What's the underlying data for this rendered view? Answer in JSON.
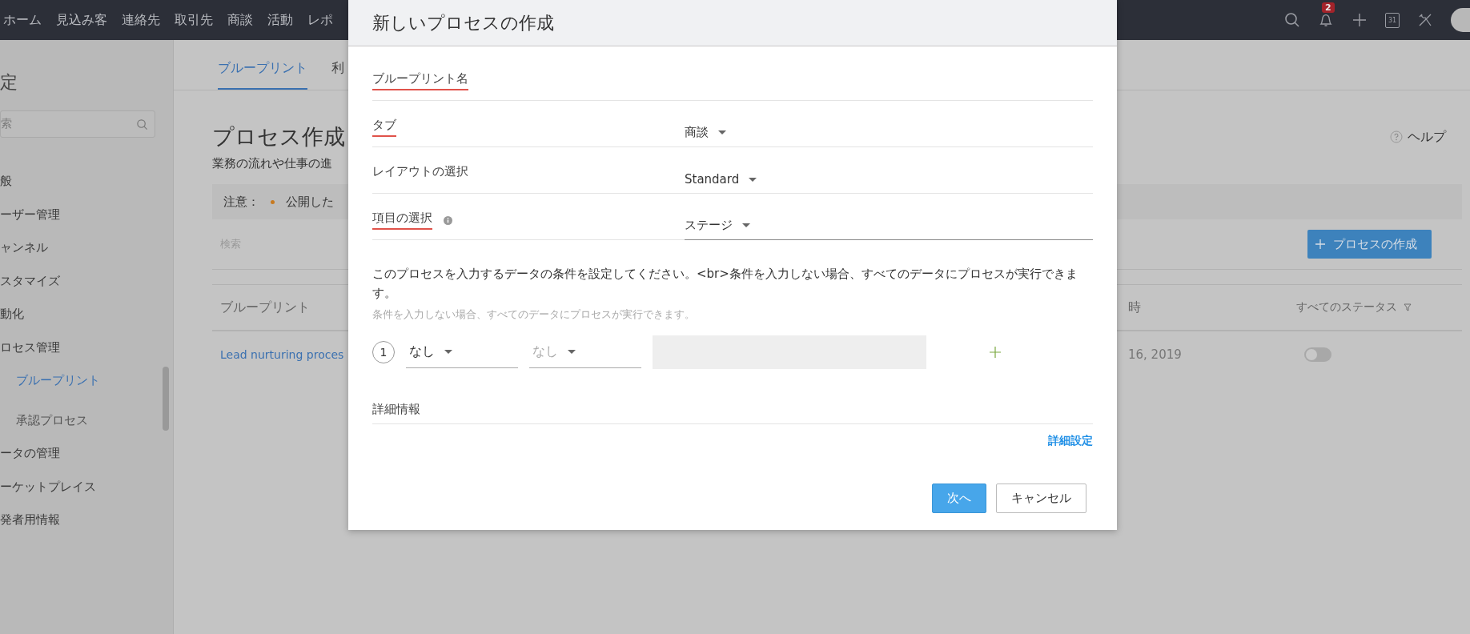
{
  "topbar": {
    "nav": [
      "ホーム",
      "見込み客",
      "連絡先",
      "取引先",
      "商談",
      "活動",
      "レポ"
    ],
    "notification_count": "2",
    "calendar_day": "31"
  },
  "sidebar": {
    "title": "定",
    "search": {
      "placeholder": "索"
    },
    "items": [
      {
        "label": "般",
        "selected": false
      },
      {
        "label": "ーザー管理",
        "selected": false
      },
      {
        "label": "ャンネル",
        "selected": false
      },
      {
        "label": "スタマイズ",
        "selected": false
      },
      {
        "label": "動化",
        "selected": false
      },
      {
        "label": "ロセス管理",
        "selected": false,
        "children": [
          {
            "label": "ブループリント",
            "selected": true
          },
          {
            "label": "承認プロセス",
            "selected": false
          }
        ]
      },
      {
        "label": "ータの管理",
        "selected": false
      },
      {
        "label": "ーケットプレイス",
        "selected": false
      },
      {
        "label": "発者用情報",
        "selected": false
      }
    ]
  },
  "page": {
    "tabs": [
      {
        "label": "ブループリント",
        "selected": true
      },
      {
        "label": "利",
        "selected": false
      }
    ],
    "title": "プロセス作成",
    "subtitle": "業務の流れや仕事の進",
    "help": "ヘルプ",
    "notice": {
      "label": "注意：",
      "text": "公開した"
    },
    "search": {
      "placeholder": "検索"
    },
    "create_button": "プロセスの作成",
    "table": {
      "columns": [
        "ブループリント",
        "時",
        "すべてのステータス"
      ],
      "rows": [
        {
          "name": "Lead nurturing proces",
          "date": "16, 2019",
          "on": false
        }
      ]
    }
  },
  "dialog": {
    "title": "新しいプロセスの作成",
    "fields": [
      {
        "kind": "text",
        "label": "ブループリント名",
        "required": true
      },
      {
        "kind": "select",
        "label": "タブ",
        "required": true,
        "value": "商談"
      },
      {
        "kind": "select",
        "label": "レイアウトの選択",
        "required": false,
        "value": "Standard"
      },
      {
        "kind": "select",
        "label": "項目の選択",
        "required": true,
        "info": true,
        "value": "ステージ"
      }
    ],
    "description": "このプロセスを入力するデータの条件を設定してください。<br>条件を入力しない場合、すべてのデータにプロセスが実行できます。",
    "hint": "条件を入力しない場合、すべてのデータにプロセスが実行できます。",
    "condition": {
      "number": "1",
      "field": "なし",
      "operator": "なし",
      "operator_disabled": true
    },
    "details_label": "詳細情報",
    "advanced_link": "詳細設定",
    "buttons": [
      {
        "kind": "primary",
        "label": "次へ"
      },
      {
        "kind": "secondary",
        "label": "キャンセル"
      }
    ]
  }
}
